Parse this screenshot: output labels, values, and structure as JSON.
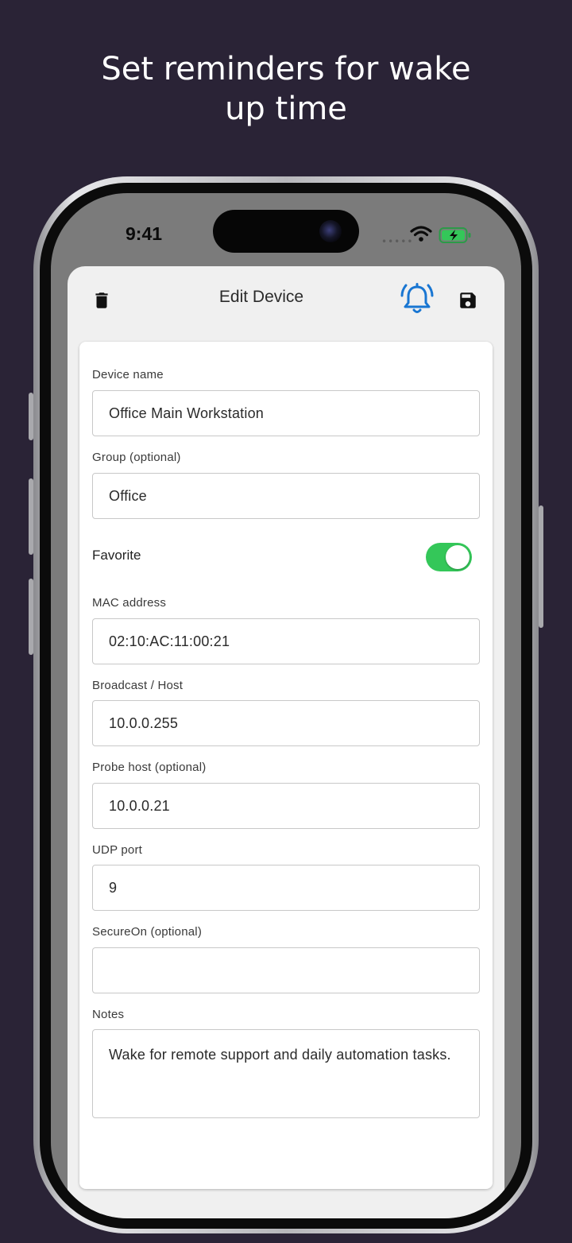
{
  "promo": {
    "headline_line1": "Set reminders for wake",
    "headline_line2": "up time"
  },
  "status_bar": {
    "time": "9:41",
    "icons": [
      "wifi-icon",
      "battery-charging-icon"
    ]
  },
  "appbar": {
    "title": "Edit Device",
    "left_icon": "trash-icon",
    "right_icons": [
      "bell-icon",
      "save-icon"
    ],
    "bell_color": "#1976d2"
  },
  "form": {
    "device_name": {
      "label": "Device name",
      "value": "Office Main Workstation"
    },
    "group": {
      "label": "Group (optional)",
      "value": "Office"
    },
    "favorite": {
      "label": "Favorite",
      "on": true,
      "color": "#34c759"
    },
    "mac": {
      "label": "MAC address",
      "value": "02:10:AC:11:00:21"
    },
    "broadcast": {
      "label": "Broadcast / Host",
      "value": "10.0.0.255"
    },
    "probe": {
      "label": "Probe host (optional)",
      "value": "10.0.0.21"
    },
    "udp": {
      "label": "UDP port",
      "value": "9"
    },
    "secureon": {
      "label": "SecureOn (optional)",
      "value": ""
    },
    "notes": {
      "label": "Notes",
      "value": "Wake for remote support and daily automation tasks."
    }
  },
  "colors": {
    "background": "#2a2336",
    "accent": "#1976d2",
    "toggle_on": "#34c759"
  }
}
